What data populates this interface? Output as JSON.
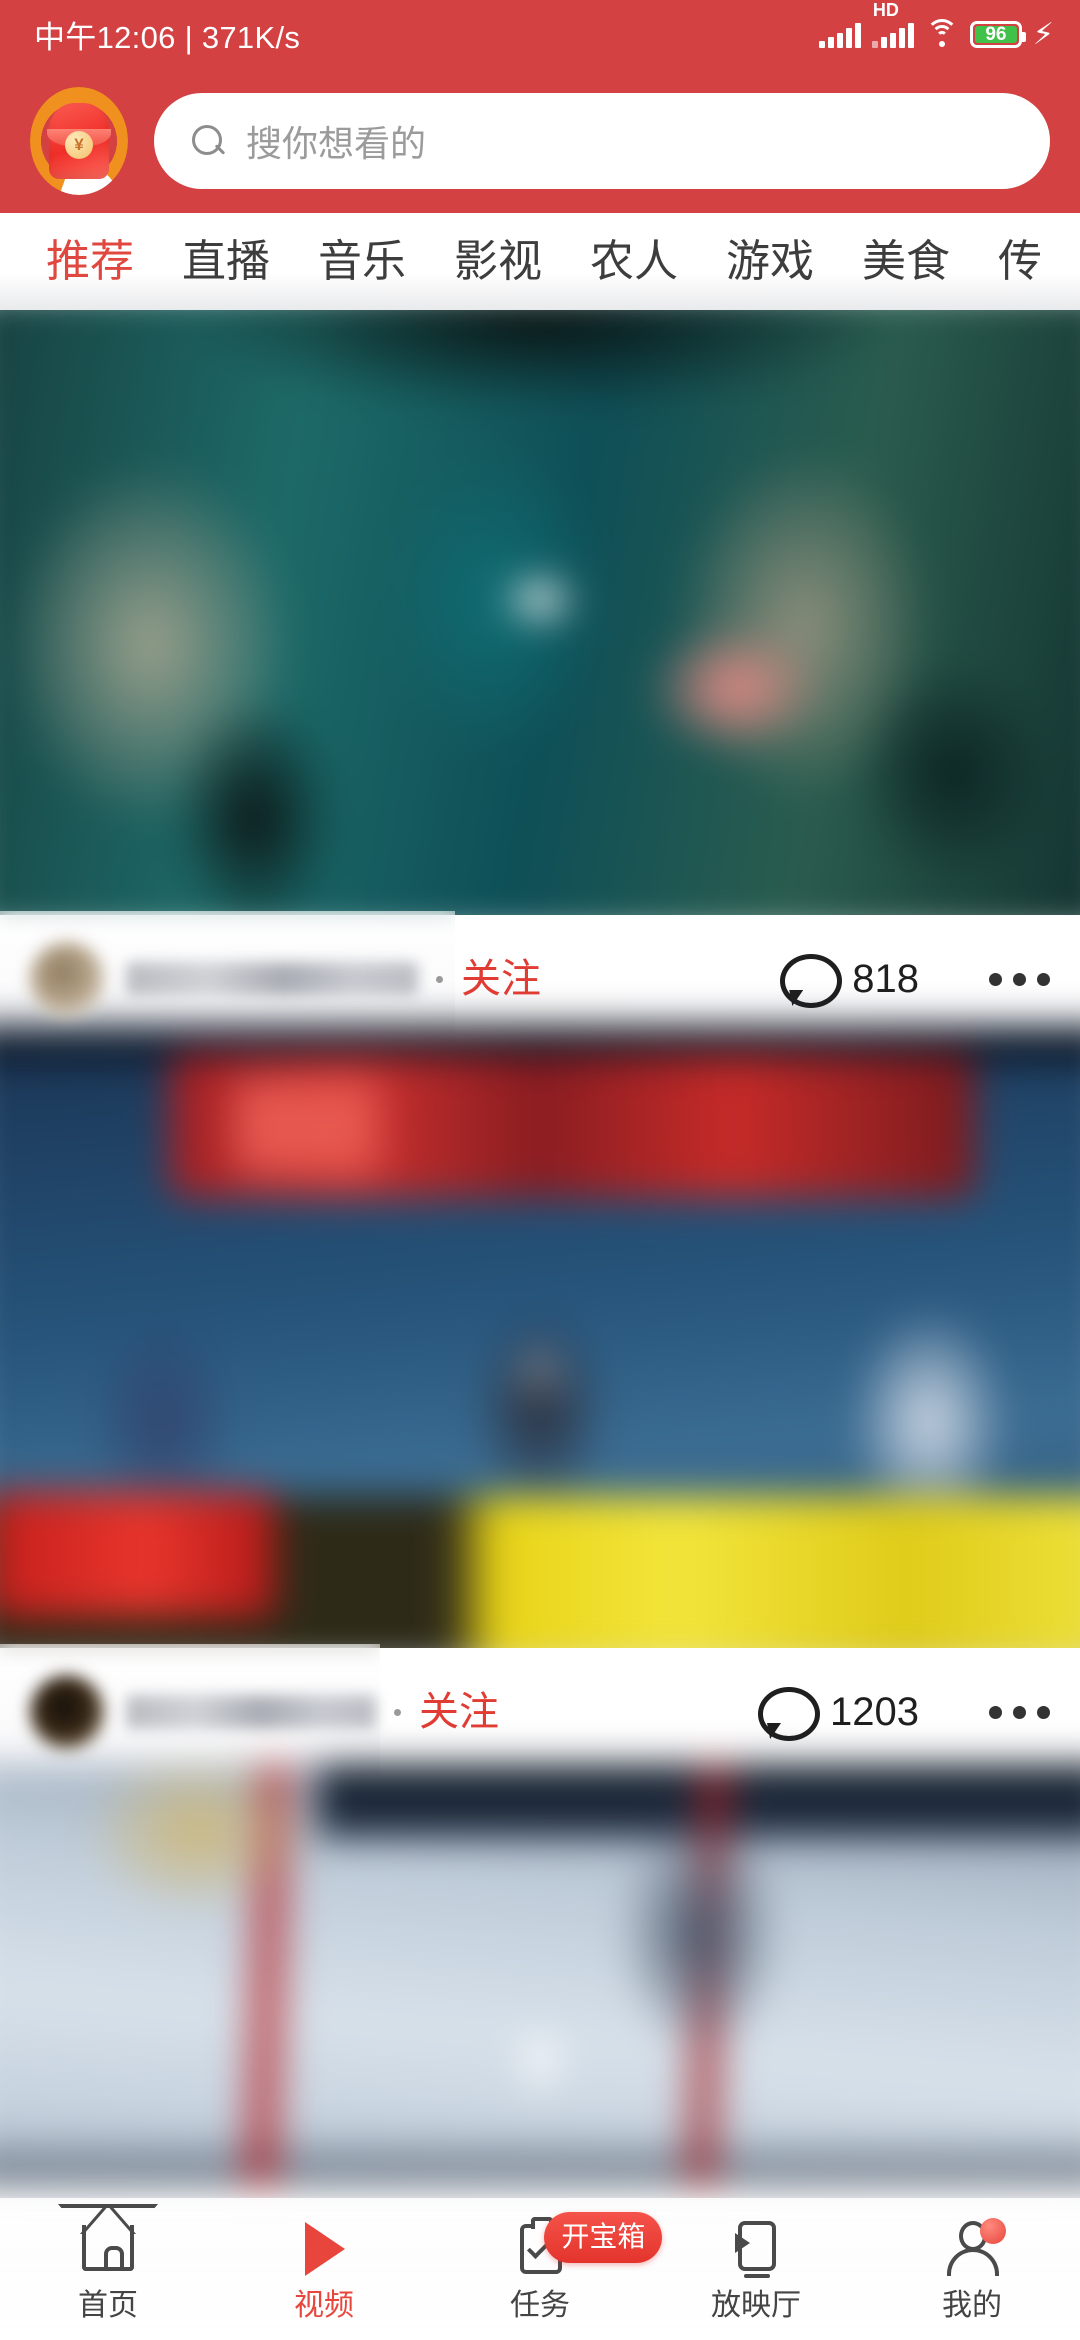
{
  "statusbar": {
    "time": "中午12:06 | 371K/s",
    "hd_label": "HD",
    "battery_level": "96",
    "battery_color": "#41c14a",
    "icons": [
      "signal-icon",
      "signal-icon",
      "hd-icon",
      "wifi-icon",
      "battery-icon",
      "charging-bolt-icon"
    ]
  },
  "header": {
    "brand_color": "#d34142",
    "redpacket_icon": "red-packet-icon",
    "redpacket_symbol": "¥",
    "search": {
      "placeholder": "搜你想看的",
      "value": "",
      "icon": "search-icon"
    }
  },
  "tabs": {
    "active_index": 0,
    "active_color": "#e0483f",
    "items": [
      {
        "label": "推荐"
      },
      {
        "label": "直播"
      },
      {
        "label": "音乐"
      },
      {
        "label": "影视"
      },
      {
        "label": "农人"
      },
      {
        "label": "游戏"
      },
      {
        "label": "美食"
      },
      {
        "label": "传"
      }
    ]
  },
  "feed": {
    "cards": [
      {
        "thumbnail": "blurred-video-thumbnail-teal-stage",
        "username": "",
        "avatar": "user-avatar",
        "separator": "·",
        "follow_label": "关注",
        "follow_color": "#e03c33",
        "comment_icon": "comment-icon",
        "comment_count": "818",
        "more_icon": "more-options-icon"
      },
      {
        "thumbnail": "blurred-video-thumbnail-blue-poster",
        "username": "",
        "avatar": "user-avatar",
        "separator": "·",
        "follow_label": "关注",
        "follow_color": "#e03c33",
        "comment_icon": "comment-icon",
        "comment_count": "1203",
        "more_icon": "more-options-icon"
      },
      {
        "thumbnail": "blurred-video-thumbnail-pale-blue",
        "partially_visible": true
      }
    ]
  },
  "bottomnav": {
    "active_index": 1,
    "active_color": "#e8463c",
    "items": [
      {
        "label": "首页",
        "icon": "home-icon"
      },
      {
        "label": "视频",
        "icon": "play-icon"
      },
      {
        "label": "任务",
        "icon": "clipboard-check-icon",
        "badge": "开宝箱"
      },
      {
        "label": "放映厅",
        "icon": "screening-room-icon"
      },
      {
        "label": "我的",
        "icon": "user-icon",
        "dot_badge": true
      }
    ]
  }
}
